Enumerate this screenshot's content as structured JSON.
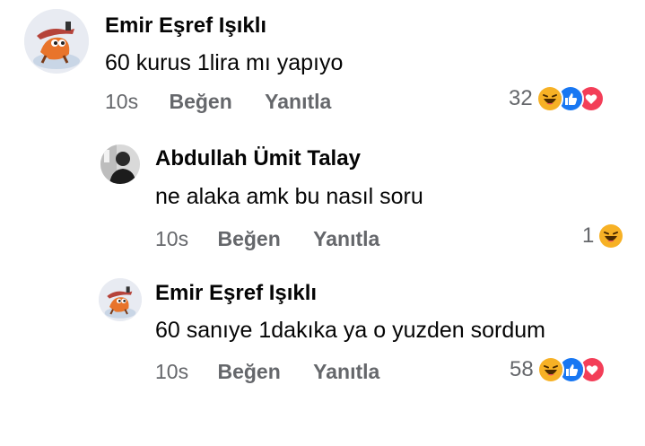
{
  "comments": [
    {
      "author": "Emir Eşref Işıklı",
      "text": "60 kurus 1lira mı yapıyo",
      "time": "10s",
      "like_label": "Beğen",
      "reply_label": "Yanıtla",
      "reaction_count": "32",
      "reactions": [
        "haha",
        "like",
        "love"
      ]
    },
    {
      "author": "Abdullah Ümit Talay",
      "text": "ne alaka amk bu nasıl soru",
      "time": "10s",
      "like_label": "Beğen",
      "reply_label": "Yanıtla",
      "reaction_count": "1",
      "reactions": [
        "haha"
      ]
    },
    {
      "author": "Emir Eşref Işıklı",
      "text": "60 sanıye 1dakıka ya o yuzden sordum",
      "time": "10s",
      "like_label": "Beğen",
      "reply_label": "Yanıtla",
      "reaction_count": "58",
      "reactions": [
        "haha",
        "like",
        "love"
      ]
    }
  ],
  "colors": {
    "name": "#050505",
    "meta": "#65676b",
    "like": "#1877f2",
    "love": "#f33e58",
    "haha": "#f7b125"
  }
}
